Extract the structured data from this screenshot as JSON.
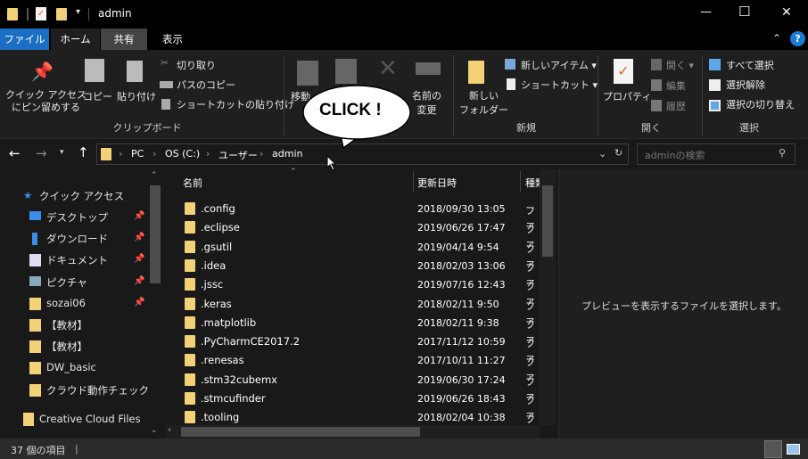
{
  "window": {
    "title": "admin",
    "minimize": "—",
    "maximize": "☐",
    "close": "✕"
  },
  "tabs": [
    "ファイル",
    "ホーム",
    "共有",
    "表示"
  ],
  "ribbon": {
    "clipboard": {
      "pin": "クイック アクセス\nにピン留めする",
      "copy": "コピー",
      "paste": "貼り付け",
      "cut": "切り取り",
      "copy_path": "パスのコピー",
      "paste_shortcut": "ショートカットの貼り付け",
      "label": "クリップボード"
    },
    "organize": {
      "move": "移動",
      "rename": "名前の\n変更"
    },
    "new": {
      "new_folder": "新しい\nフォルダー",
      "new_item": "新しいアイテム ▾",
      "shortcut": "ショートカット ▾",
      "label": "新規"
    },
    "open": {
      "properties": "プロパティ",
      "open": "開く ▾",
      "edit": "編集",
      "history": "履歴",
      "label": "開く"
    },
    "select": {
      "all": "すべて選択",
      "none": "選択解除",
      "invert": "選択の切り替え",
      "label": "選択"
    }
  },
  "address": {
    "crumbs": [
      "PC",
      "OS (C:)",
      "ユーザー",
      "admin"
    ],
    "search_placeholder": "adminの検索"
  },
  "nav": {
    "quick_access": "クイック アクセス",
    "items": [
      {
        "label": "デスクトップ",
        "icon": "desktop-icon",
        "pinned": true
      },
      {
        "label": "ダウンロード",
        "icon": "download-icon",
        "pinned": true
      },
      {
        "label": "ドキュメント",
        "icon": "document-icon",
        "pinned": true
      },
      {
        "label": "ピクチャ",
        "icon": "picture-icon",
        "pinned": true
      },
      {
        "label": "sozai06",
        "icon": "folder-icon",
        "pinned": true
      },
      {
        "label": "【教材】",
        "icon": "folder-icon",
        "pinned": false
      },
      {
        "label": "【教材】",
        "icon": "folder-icon",
        "pinned": false
      },
      {
        "label": "DW_basic",
        "icon": "folder-icon",
        "pinned": false
      },
      {
        "label": "クラウド動作チェック",
        "icon": "folder-icon",
        "pinned": false
      }
    ],
    "creative_cloud": "Creative Cloud Files"
  },
  "columns": {
    "name": "名前",
    "date": "更新日時",
    "type": "種類"
  },
  "files": [
    {
      "name": ".config",
      "date": "2018/09/30 13:05",
      "type": "ファ"
    },
    {
      "name": ".eclipse",
      "date": "2019/06/26 17:47",
      "type": "ファ"
    },
    {
      "name": ".gsutil",
      "date": "2019/04/14 9:54",
      "type": "ファ"
    },
    {
      "name": ".idea",
      "date": "2018/02/03 13:06",
      "type": "ファ"
    },
    {
      "name": ".jssc",
      "date": "2019/07/16 12:43",
      "type": "ファ"
    },
    {
      "name": ".keras",
      "date": "2018/02/11 9:50",
      "type": "ファ"
    },
    {
      "name": ".matplotlib",
      "date": "2018/02/11 9:38",
      "type": "ファ"
    },
    {
      "name": ".PyCharmCE2017.2",
      "date": "2017/11/12 10:59",
      "type": "ファ"
    },
    {
      "name": ".renesas",
      "date": "2017/10/11 11:27",
      "type": "ファ"
    },
    {
      "name": ".stm32cubemx",
      "date": "2019/06/30 17:24",
      "type": "ファ"
    },
    {
      "name": ".stmcufinder",
      "date": "2019/06/26 18:43",
      "type": "ファ"
    },
    {
      "name": ".tooling",
      "date": "2018/02/04 10:38",
      "type": "ファ"
    }
  ],
  "preview_text": "プレビューを表示するファイルを選択します。",
  "status": {
    "count": "37 個の項目"
  },
  "callout": "CLICK !",
  "colors": {
    "file_tab": "#1a6fc4",
    "folder": "#f2d177",
    "bg": "#191919"
  }
}
